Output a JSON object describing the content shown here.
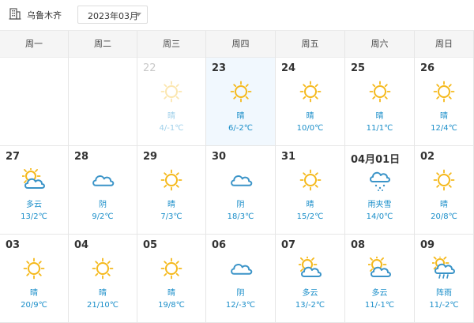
{
  "city": {
    "name": "乌鲁木齐"
  },
  "month_select": {
    "value": "2023年03月"
  },
  "weekdays": [
    "周一",
    "周二",
    "周三",
    "周四",
    "周五",
    "周六",
    "周日"
  ],
  "weeks": [
    [
      {
        "empty": true
      },
      {
        "empty": true
      },
      {
        "day": "22",
        "cond": "晴",
        "temp": "4/-1℃",
        "icon": "sun",
        "past": true
      },
      {
        "day": "23",
        "cond": "晴",
        "temp": "6/-2℃",
        "icon": "sun",
        "today": true
      },
      {
        "day": "24",
        "cond": "晴",
        "temp": "10/0℃",
        "icon": "sun"
      },
      {
        "day": "25",
        "cond": "晴",
        "temp": "11/1℃",
        "icon": "sun"
      },
      {
        "day": "26",
        "cond": "晴",
        "temp": "12/4℃",
        "icon": "sun"
      }
    ],
    [
      {
        "day": "27",
        "cond": "多云",
        "temp": "13/2℃",
        "icon": "partly-cloudy"
      },
      {
        "day": "28",
        "cond": "阴",
        "temp": "9/2℃",
        "icon": "cloud"
      },
      {
        "day": "29",
        "cond": "晴",
        "temp": "7/3℃",
        "icon": "sun"
      },
      {
        "day": "30",
        "cond": "阴",
        "temp": "18/3℃",
        "icon": "cloud"
      },
      {
        "day": "31",
        "cond": "晴",
        "temp": "15/2℃",
        "icon": "sun"
      },
      {
        "day": "04月01日",
        "cond": "雨夹雪",
        "temp": "14/0℃",
        "icon": "sleet"
      },
      {
        "day": "02",
        "cond": "晴",
        "temp": "20/8℃",
        "icon": "sun"
      }
    ],
    [
      {
        "day": "03",
        "cond": "晴",
        "temp": "20/9℃",
        "icon": "sun"
      },
      {
        "day": "04",
        "cond": "晴",
        "temp": "21/10℃",
        "icon": "sun"
      },
      {
        "day": "05",
        "cond": "晴",
        "temp": "19/8℃",
        "icon": "sun"
      },
      {
        "day": "06",
        "cond": "阴",
        "temp": "12/-3℃",
        "icon": "cloud"
      },
      {
        "day": "07",
        "cond": "多云",
        "temp": "13/-2℃",
        "icon": "partly-cloudy"
      },
      {
        "day": "08",
        "cond": "多云",
        "temp": "11/-1℃",
        "icon": "partly-cloudy"
      },
      {
        "day": "09",
        "cond": "阵雨",
        "temp": "11/-2℃",
        "icon": "shower"
      }
    ]
  ],
  "colors": {
    "sun": "#f5b91c",
    "cloud": "#3b94c8",
    "text_blue": "#1a8ec9",
    "today_bg": "#f1f8fe"
  }
}
